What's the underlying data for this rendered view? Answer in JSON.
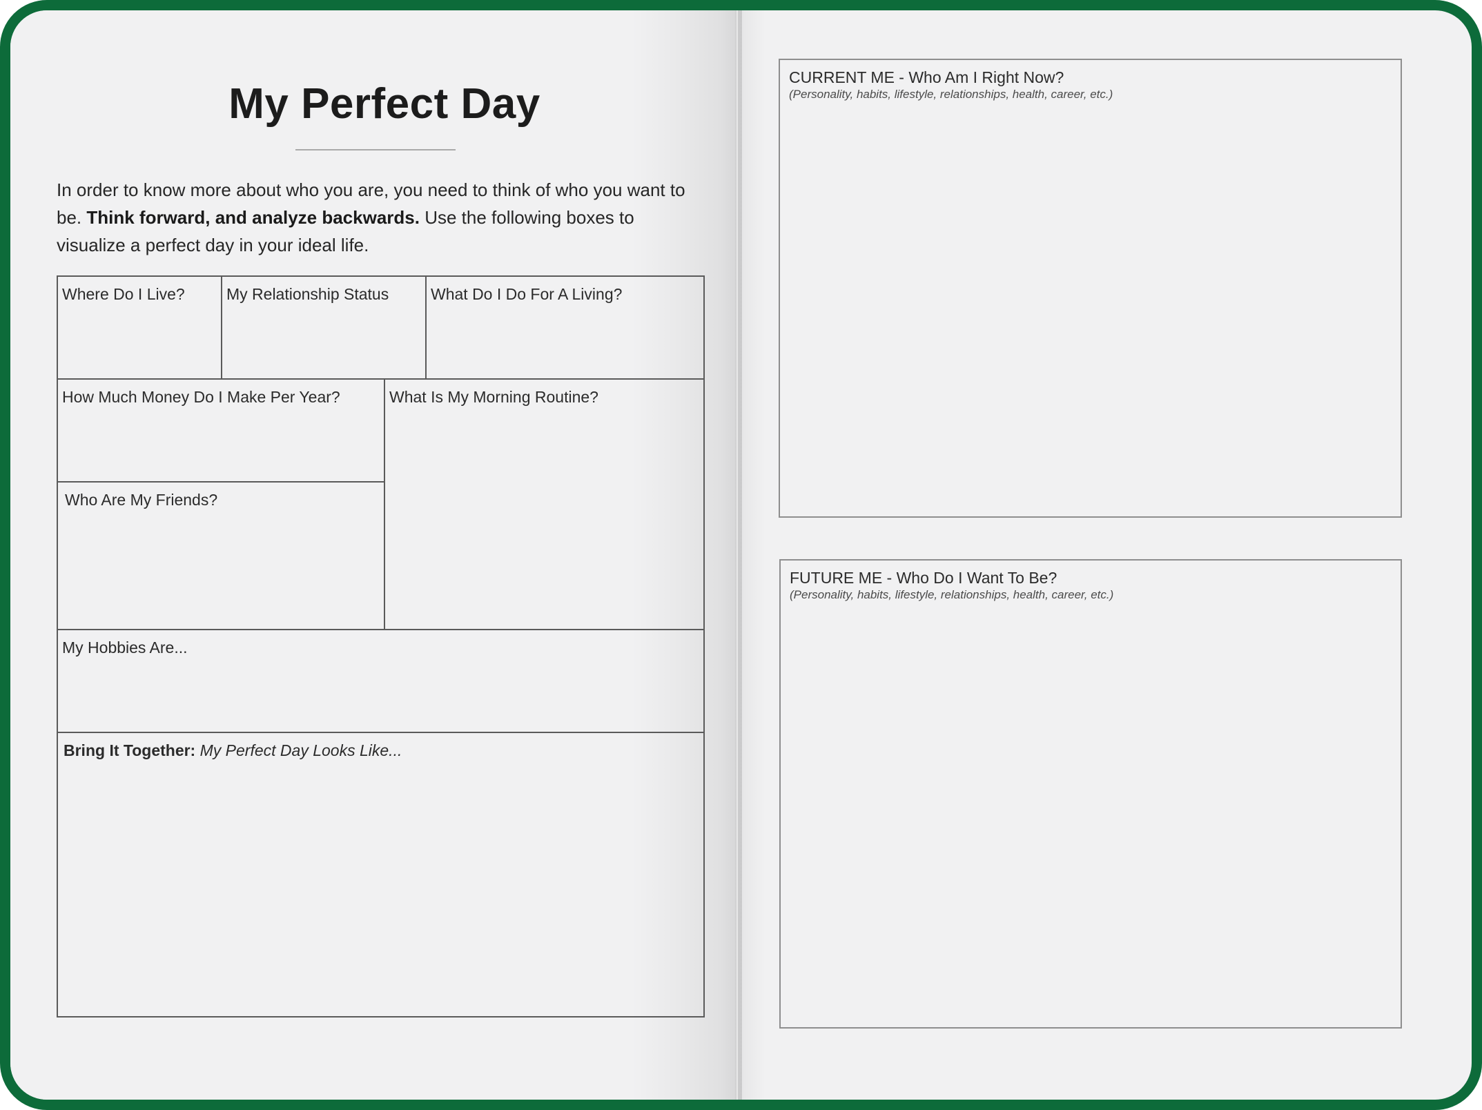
{
  "left_page": {
    "title": "My Perfect Day",
    "intro": {
      "part1": "In order to know more about who you are, you need to think of who you want to be. ",
      "bold": "Think forward, and analyze backwards.",
      "part2": " Use the following boxes to visualize a perfect day in your ideal life."
    },
    "boxes": {
      "where_live": "Where Do I Live?",
      "relationship": "My Relationship Status",
      "living": "What Do I Do For A Living?",
      "money": "How Much Money Do I Make Per Year?",
      "morning": "What Is My Morning Routine?",
      "friends": "Who Are My Friends?",
      "hobbies": "My Hobbies Are...",
      "together_bold": "Bring It Together:",
      "together_italic": " My Perfect Day Looks Like..."
    }
  },
  "right_page": {
    "current": {
      "heading": "CURRENT ME - Who Am I Right Now?",
      "sub": "(Personality, habits, lifestyle, relationships, health, career, etc.)"
    },
    "future": {
      "heading": "FUTURE ME - Who Do I Want To Be?",
      "sub": "(Personality, habits, lifestyle, relationships, health, career, etc.)"
    }
  },
  "colors": {
    "frame": "#0d6b3a",
    "paper": "#f1f1f2"
  }
}
